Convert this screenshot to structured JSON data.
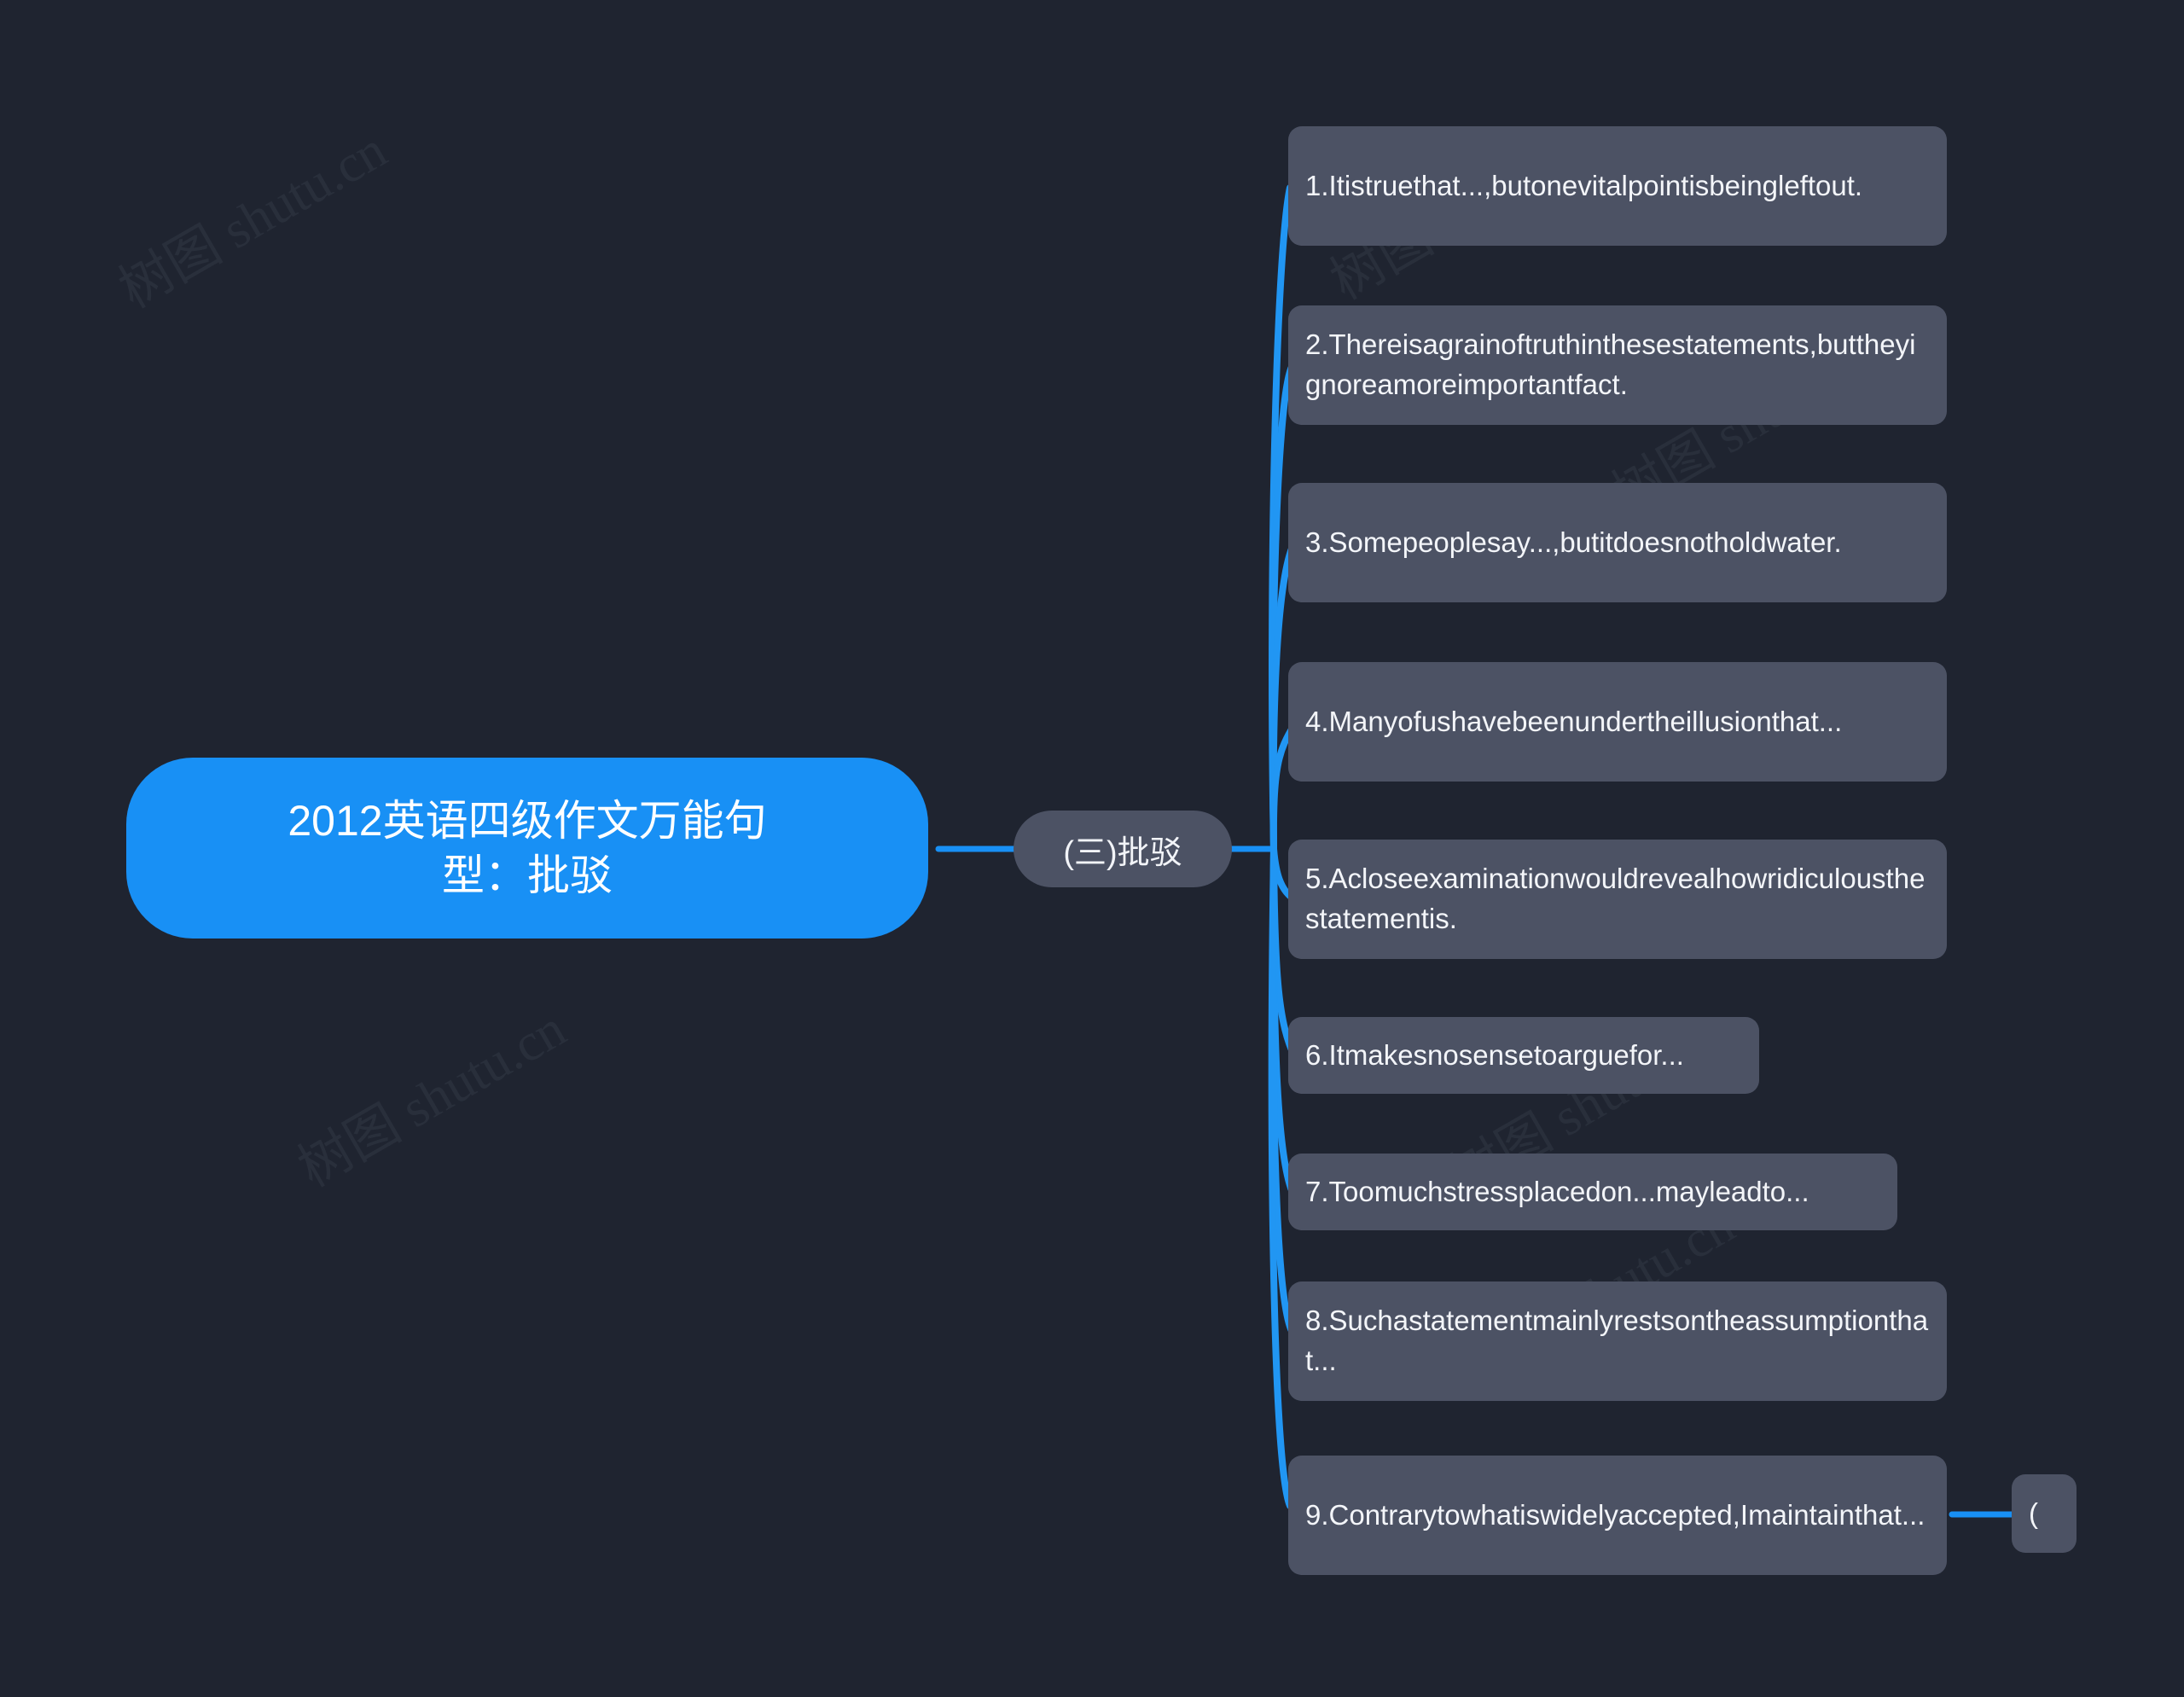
{
  "meta": {
    "background_color": "#1f2430",
    "accent_color": "#1890f5",
    "node_color": "#4c5264",
    "text_color": "#f3f5f9"
  },
  "watermark": {
    "text": "树图 shutu.cn"
  },
  "mindmap": {
    "root": {
      "label": "2012英语四级作文万能句型：批驳",
      "line1": "2012英语四级作文万能句",
      "line2": "型：批驳"
    },
    "branch": {
      "label": "(三)批驳"
    },
    "leaves": [
      {
        "label": "1.Itistruethat...,butonevitalpointisbeingleftout."
      },
      {
        "label": "2.Thereisagrainoftruthinthesestatements,buttheyignoreamoreimportantfact."
      },
      {
        "label": "3.Somepeoplesay...,butitdoesnotholdwater."
      },
      {
        "label": "4.Manyofushavebeenundertheillusionthat..."
      },
      {
        "label": "5.Acloseexaminationwouldrevealhowridiculousthestatementis."
      },
      {
        "label": "6.Itmakesnosensetoarguefor..."
      },
      {
        "label": "7.Toomuchstressplacedon...mayleadto..."
      },
      {
        "label": "8.Suchastatementmainlyrestsontheassumptionthat..."
      },
      {
        "label": "9.Contrarytowhatiswidelyaccepted,Imaintainthat..."
      }
    ],
    "stub": {
      "label": "("
    }
  }
}
